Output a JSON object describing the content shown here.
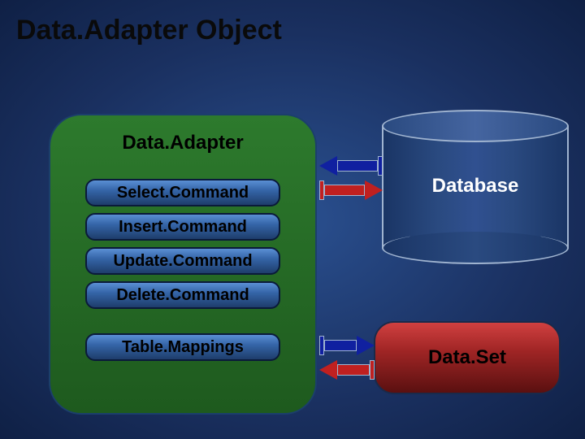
{
  "title": "Data.Adapter Object",
  "adapter": {
    "label": "Data.Adapter",
    "commands": {
      "select": "Select.Command",
      "insert": "Insert.Command",
      "update": "Update.Command",
      "delete": "Delete.Command",
      "mappings": "Table.Mappings"
    }
  },
  "database": {
    "label": "Database"
  },
  "dataset": {
    "label": "Data.Set"
  }
}
